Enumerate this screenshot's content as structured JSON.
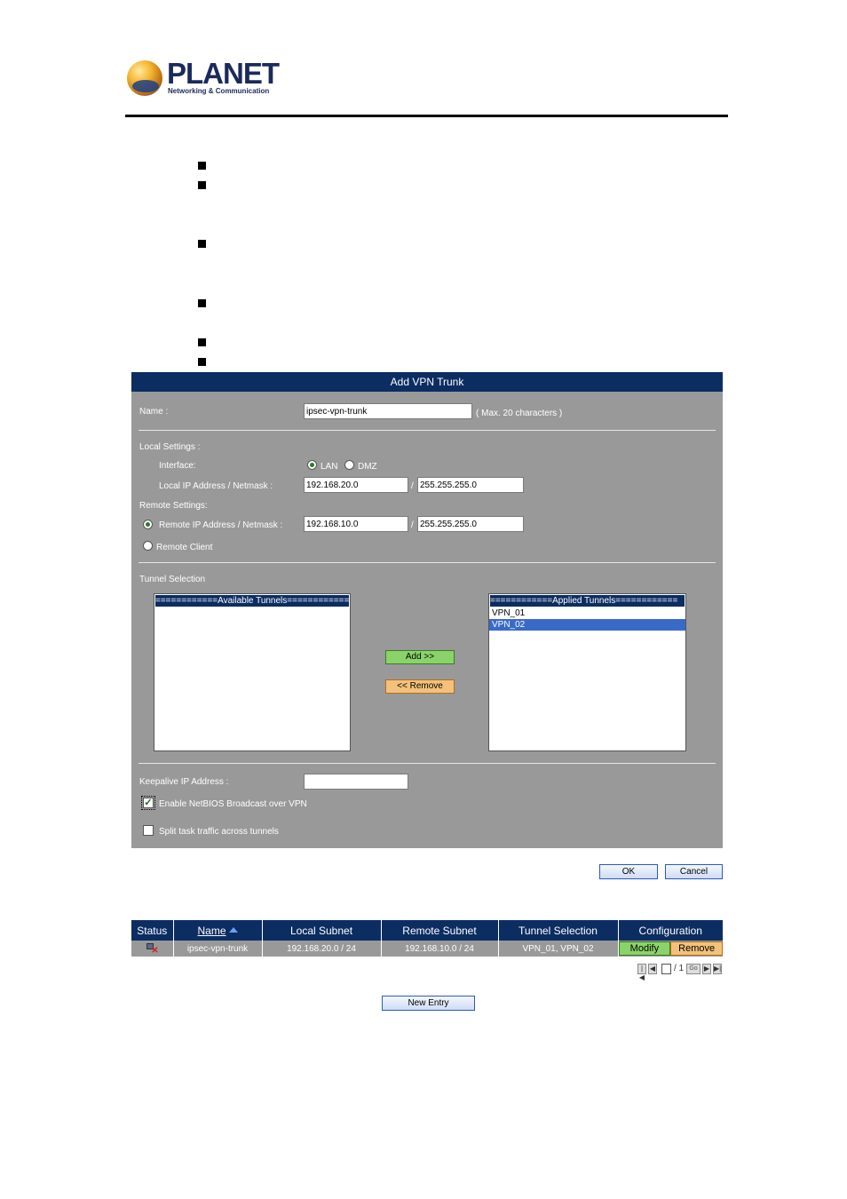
{
  "brand": {
    "name": "PLANET",
    "tagline": "Networking & Communication"
  },
  "form": {
    "title": "Add VPN Trunk",
    "name_label": "Name :",
    "name_value": "ipsec-vpn-trunk",
    "name_hint": "( Max. 20 characters )",
    "local_settings_label": "Local Settings :",
    "interface_label": "Interface:",
    "interface_options": [
      "LAN",
      "DMZ"
    ],
    "interface_selected": "LAN",
    "local_ip_label": "Local IP Address / Netmask :",
    "local_ip": "192.168.20.0",
    "local_netmask": "255.255.255.0",
    "remote_settings_label": "Remote Settings:",
    "remote_ip_label": "Remote IP Address / Netmask :",
    "remote_ip": "192.168.10.0",
    "remote_netmask": "255.255.255.0",
    "remote_client_label": "Remote Client",
    "slash": "/",
    "tunnel_selection_label": "Tunnel Selection",
    "available_header": "============Available Tunnels============",
    "applied_header": "============Applied Tunnels============",
    "applied_items": [
      "VPN_01",
      "VPN_02"
    ],
    "applied_selected": "VPN_02",
    "add_label": "Add >>",
    "remove_label": "<< Remove",
    "keepalive_label": "Keepalive IP Address :",
    "keepalive_value": "",
    "netbios_label": "Enable NetBIOS Broadcast over VPN",
    "netbios_checked": true,
    "split_label": "Split task traffic across tunnels",
    "split_checked": false,
    "ok_label": "OK",
    "cancel_label": "Cancel"
  },
  "table": {
    "headers": [
      "Status",
      "Name",
      "Local Subnet",
      "Remote Subnet",
      "Tunnel Selection",
      "Configuration"
    ],
    "rows": [
      {
        "name": "ipsec-vpn-trunk",
        "local_subnet": "192.168.20.0 / 24",
        "remote_subnet": "192.168.10.0 / 24",
        "tunnel_selection": "VPN_01, VPN_02",
        "modify_label": "Modify",
        "remove_label": "Remove"
      }
    ],
    "pager": {
      "page": "",
      "total": "/ 1",
      "go_label": "Go"
    },
    "new_entry_label": "New Entry"
  },
  "colors": {
    "header_bg": "#0c2d62",
    "panel_bg": "#999999",
    "btn_green": "#8ad36a",
    "btn_orange": "#f3c17a"
  }
}
